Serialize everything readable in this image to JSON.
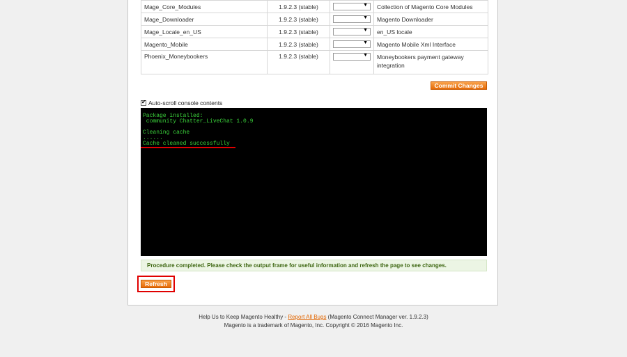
{
  "packages": [
    {
      "name": "Mage_Core_Modules",
      "version": "1.9.2.3 (stable)",
      "description": "Collection of Magento Core Modules"
    },
    {
      "name": "Mage_Downloader",
      "version": "1.9.2.3 (stable)",
      "description": "Magento Downloader"
    },
    {
      "name": "Mage_Locale_en_US",
      "version": "1.9.2.3 (stable)",
      "description": "en_US locale"
    },
    {
      "name": "Magento_Mobile",
      "version": "1.9.2.3 (stable)",
      "description": "Magento Mobile Xml Interface"
    },
    {
      "name": "Phoenix_Moneybookers",
      "version": "1.9.2.3 (stable)",
      "description": "Moneybookers payment gateway integration"
    }
  ],
  "select_arrow": "▼",
  "commit_label": "Commit Changes",
  "autoscroll_label": "Auto-scroll console contents",
  "console_lines": [
    "Package installed:",
    " community Chatter_LiveChat 1.0.9",
    "",
    "Cleaning cache",
    "......",
    "Cache cleaned successfully"
  ],
  "notice": "Procedure completed. Please check the output frame for useful information and refresh the page to see changes.",
  "refresh_label": "Refresh",
  "footer": {
    "line1_prefix": "Help Us to Keep Magento Healthy - ",
    "report_link": "Report All Bugs",
    "line1_suffix": " (Magento Connect Manager ver. 1.9.2.3)",
    "line2": "Magento is a trademark of Magento, Inc. Copyright © 2016 Magento Inc."
  },
  "colors": {
    "accent": "#e66a06",
    "console_text": "#3bd33b",
    "highlight": "#e00000"
  }
}
